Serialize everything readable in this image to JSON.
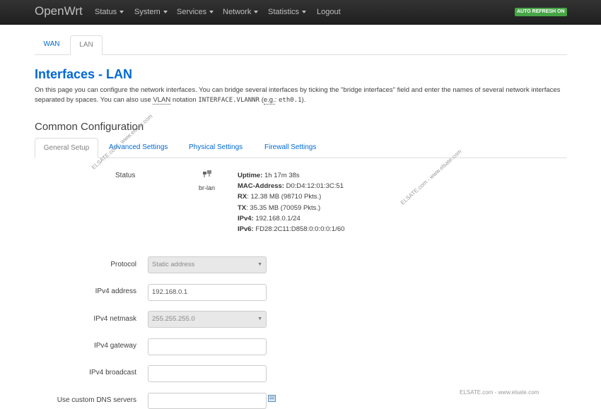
{
  "navbar": {
    "brand": "OpenWrt",
    "menu": [
      "Status",
      "System",
      "Services",
      "Network",
      "Statistics"
    ],
    "logout": "Logout",
    "auto_refresh": "AUTO REFRESH ON"
  },
  "tabs": [
    "WAN",
    "LAN"
  ],
  "page": {
    "title": "Interfaces - LAN",
    "desc_1": "On this page you can configure the network interfaces. You can bridge several interfaces by ticking the \"bridge interfaces\" field and enter the names of several network interfaces separated by spaces. You can also use ",
    "desc_vlan": "VLAN",
    "desc_2": " notation ",
    "desc_code": "INTERFACE.VLANNR",
    "desc_3": " (",
    "desc_eg": "e.g.",
    "desc_4": ": ",
    "desc_code2": "eth0.1",
    "desc_5": ")."
  },
  "section": {
    "title": "Common Configuration",
    "subtabs": [
      "General Setup",
      "Advanced Settings",
      "Physical Settings",
      "Firewall Settings"
    ]
  },
  "status": {
    "label": "Status",
    "device": "br-lan",
    "uptime_label": "Uptime:",
    "uptime": "1h 17m 38s",
    "mac_label": "MAC-Address:",
    "mac": "D0:D4:12:01:3C:51",
    "rx_label": "RX",
    "rx": ": 12.38 MB (98710 Pkts.)",
    "tx_label": "TX",
    "tx": ": 35.35 MB (70059 Pkts.)",
    "ipv4_label": "IPv4:",
    "ipv4": "192.168.0.1/24",
    "ipv6_label": "IPv6:",
    "ipv6": "FD28:2C11:D858:0:0:0:0:1/60"
  },
  "form": {
    "protocol_label": "Protocol",
    "protocol_value": "Static address",
    "ipv4_address_label": "IPv4 address",
    "ipv4_address_value": "192.168.0.1",
    "ipv4_netmask_label": "IPv4 netmask",
    "ipv4_netmask_value": "255.255.255.0",
    "ipv4_gateway_label": "IPv4 gateway",
    "ipv4_gateway_value": "",
    "ipv4_broadcast_label": "IPv4 broadcast",
    "ipv4_broadcast_value": "",
    "dns_label": "Use custom DNS servers",
    "dns_value": ""
  },
  "watermarks": [
    "ELSATE.com - www.elsate.com",
    "ELSATE.com - www.elsate.com",
    "ELSATE.com - www.elsate.com"
  ],
  "colors": {
    "accent": "#0069d6",
    "navbar": "#222222",
    "badge": "#46a546"
  }
}
